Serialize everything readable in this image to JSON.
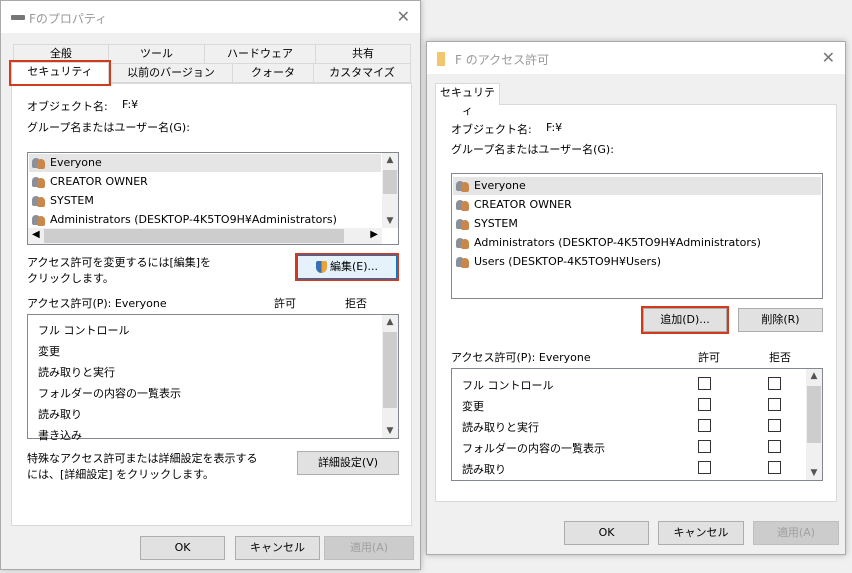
{
  "left": {
    "title": "Fのプロパティ",
    "tabs_row1": [
      "全般",
      "ツール",
      "ハードウェア",
      "共有"
    ],
    "tabs_row2": [
      "セキュリティ",
      "以前のバージョン",
      "クォータ",
      "カスタマイズ"
    ],
    "object_label": "オブジェクト名:",
    "object_value": "F:¥",
    "group_label": "グループ名またはユーザー名(G):",
    "users": [
      "Everyone",
      "CREATOR OWNER",
      "SYSTEM",
      "Administrators (DESKTOP-4K5TO9H¥Administrators)"
    ],
    "edit_hint": [
      "アクセス許可を変更するには[編集]を",
      "クリックします。"
    ],
    "edit_button": "編集(E)...",
    "perm_header": "アクセス許可(P): Everyone",
    "allow": "許可",
    "deny": "拒否",
    "perms": [
      "フル コントロール",
      "変更",
      "読み取りと実行",
      "フォルダーの内容の一覧表示",
      "読み取り",
      "書き込み"
    ],
    "adv_hint": [
      "特殊なアクセス許可または詳細設定を表示する",
      "には、[詳細設定] をクリックします。"
    ],
    "adv_button": "詳細設定(V)",
    "ok": "OK",
    "cancel": "キャンセル",
    "apply": "適用(A)"
  },
  "right": {
    "title": "F のアクセス許可",
    "tab": "セキュリティ",
    "object_label": "オブジェクト名:",
    "object_value": "F:¥",
    "group_label": "グループ名またはユーザー名(G):",
    "users": [
      "Everyone",
      "CREATOR OWNER",
      "SYSTEM",
      "Administrators (DESKTOP-4K5TO9H¥Administrators)",
      "Users (DESKTOP-4K5TO9H¥Users)"
    ],
    "add_button": "追加(D)...",
    "remove_button": "削除(R)",
    "perm_header": "アクセス許可(P): Everyone",
    "allow": "許可",
    "deny": "拒否",
    "perms": [
      "フル コントロール",
      "変更",
      "読み取りと実行",
      "フォルダーの内容の一覧表示",
      "読み取り"
    ],
    "ok": "OK",
    "cancel": "キャンセル",
    "apply": "適用(A)"
  },
  "colors": {
    "highlight": "#d13b1c"
  }
}
